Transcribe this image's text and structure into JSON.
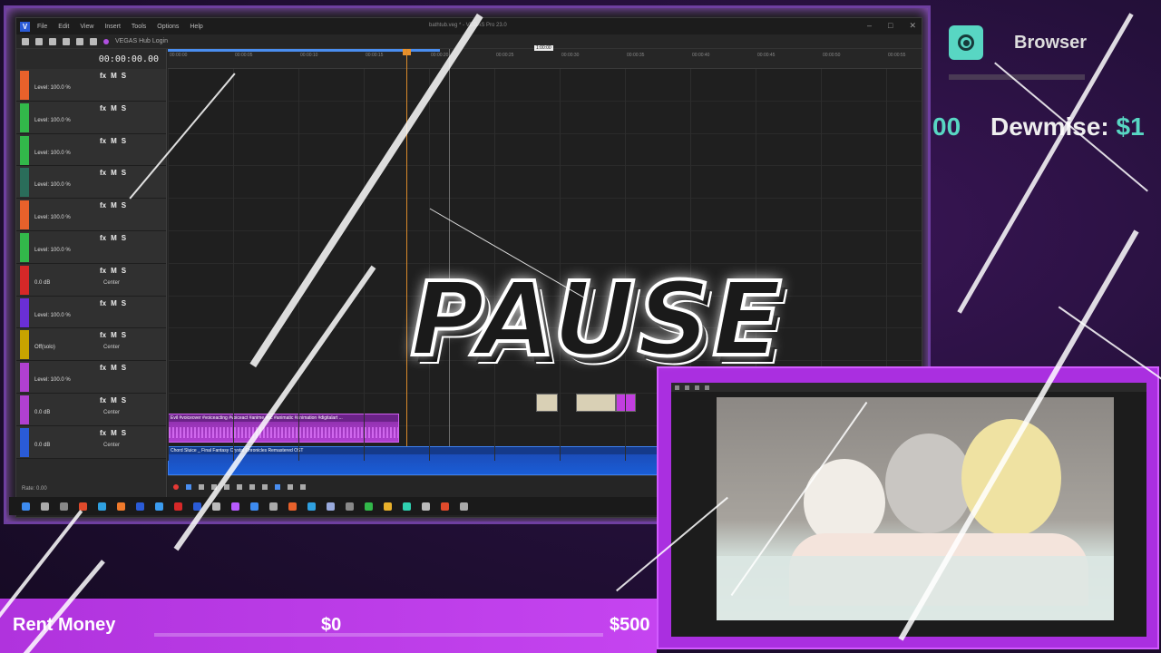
{
  "vegas": {
    "menu": [
      "File",
      "Edit",
      "View",
      "Insert",
      "Tools",
      "Options",
      "Help"
    ],
    "window_title": "bathtub.veg * - VEGAS Pro 23.0",
    "toolbar_hub": "VEGAS Hub Login",
    "timecode": "00:00:00.00",
    "cursor_tag": "1:00:00",
    "ruler_labels": [
      "00:00:00",
      "00:00:05",
      "00:00:10",
      "00:00:15",
      "00:00:20",
      "00:00:25",
      "00:00:30",
      "00:00:35",
      "00:00:40",
      "00:00:45",
      "00:00:50",
      "00:00:55"
    ],
    "tracks": [
      {
        "level": "Level: 100.0 %",
        "color": "#e8612b"
      },
      {
        "level": "Level: 100.0 %",
        "color": "#32b84a"
      },
      {
        "level": "Level: 100.0 %",
        "color": "#32b84a"
      },
      {
        "level": "Level: 100.0 %",
        "color": "#2a6d5a"
      },
      {
        "level": "Level: 100.0 %",
        "color": "#e8612b"
      },
      {
        "level": "Level: 100.0 %",
        "color": "#32b84a"
      },
      {
        "level": "0.0 dB",
        "center": "Center",
        "color": "#d62828"
      },
      {
        "level": "Level: 100.0 %",
        "color": "#6a2fd6"
      },
      {
        "level": "Off(solo)",
        "center": "Center",
        "color": "#c7a300"
      },
      {
        "level": "Level: 100.0 %",
        "color": "#b040d0"
      },
      {
        "level": "0.0 dB",
        "center": "Center",
        "color": "#b040d0"
      },
      {
        "level": "0.0 dB",
        "center": "Center",
        "color": "#2a5bd7"
      }
    ],
    "rate": "Rate: 0.00",
    "clip_purple_name": "Evil #voiceover #voiceacting #voiceact #anime #oc #animatic #animation #digitalart ...",
    "clip_blue_name": "Chord Sluice _ Final Fantasy Crystal Chronicles Remastered OST"
  },
  "overlay": {
    "browser_label": "Browser",
    "donation_partial_amount": "00",
    "donation_name": "Dewmise:",
    "donation_amount": "$1",
    "pause_text": "PAUSE",
    "rent_label": "Rent Money",
    "rent_current": "$0",
    "rent_goal": "$500",
    "rent_progress": 0
  },
  "colors": {
    "accent_purple": "#b033dd",
    "accent_teal": "#58d6c3",
    "vegas_blue": "#2a5bd7"
  }
}
